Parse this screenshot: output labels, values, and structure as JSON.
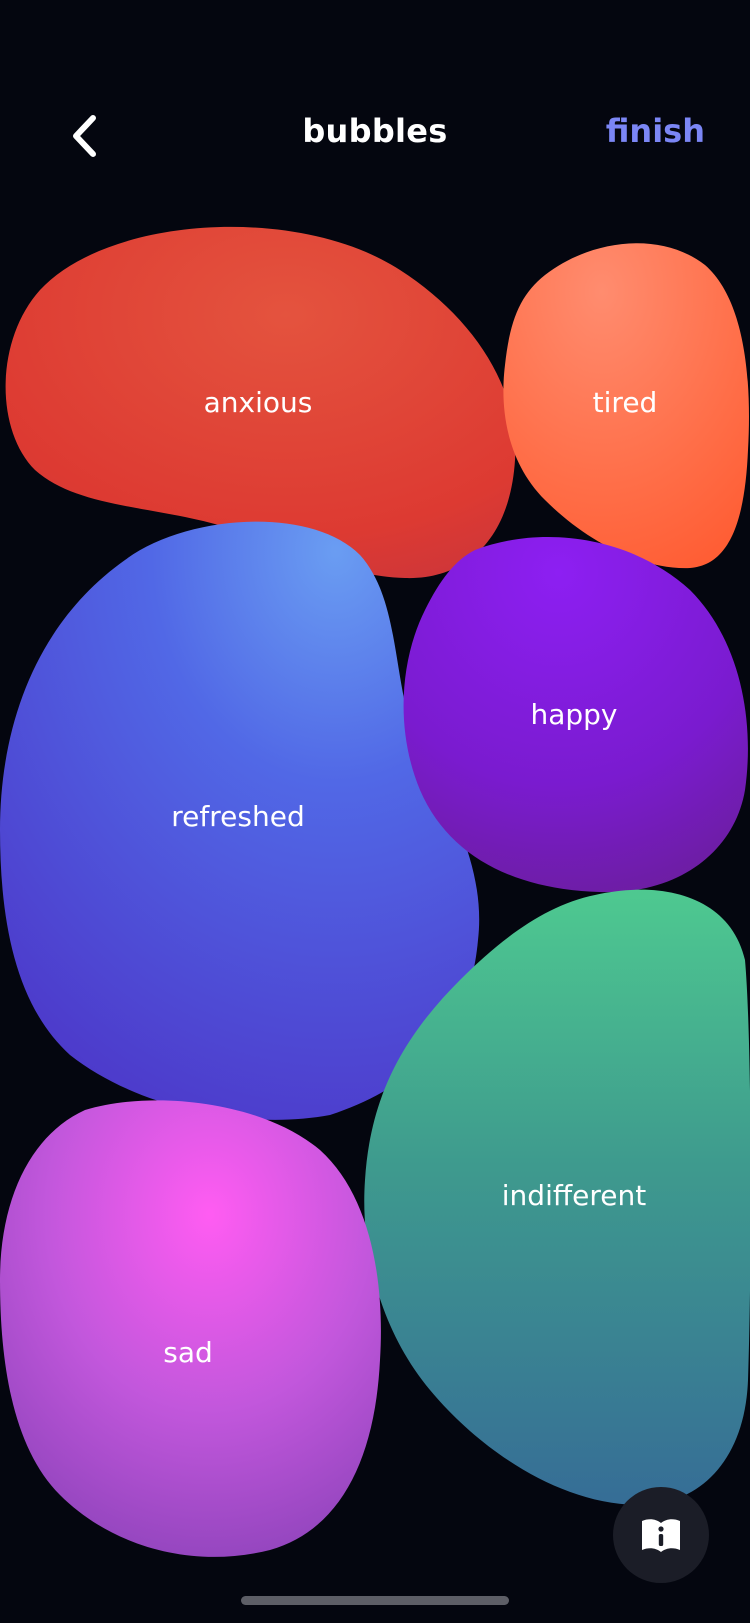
{
  "header": {
    "title": "bubbles",
    "finish_label": "finish",
    "back_icon": "chevron-left-icon"
  },
  "bubbles": [
    {
      "label": "anxious",
      "color": "#e0443a"
    },
    {
      "label": "tired",
      "color": "#ff6a45"
    },
    {
      "label": "refreshed",
      "color": "#4f55e0"
    },
    {
      "label": "happy",
      "color": "#7a1fd6"
    },
    {
      "label": "indifferent",
      "color": "#3f9d8f"
    },
    {
      "label": "sad",
      "color": "#c152e0"
    }
  ],
  "info_button": {
    "icon": "book-info-icon"
  },
  "colors": {
    "background": "#04060f",
    "accent": "#7b86f5",
    "info_button_bg": "#1b1d27"
  }
}
